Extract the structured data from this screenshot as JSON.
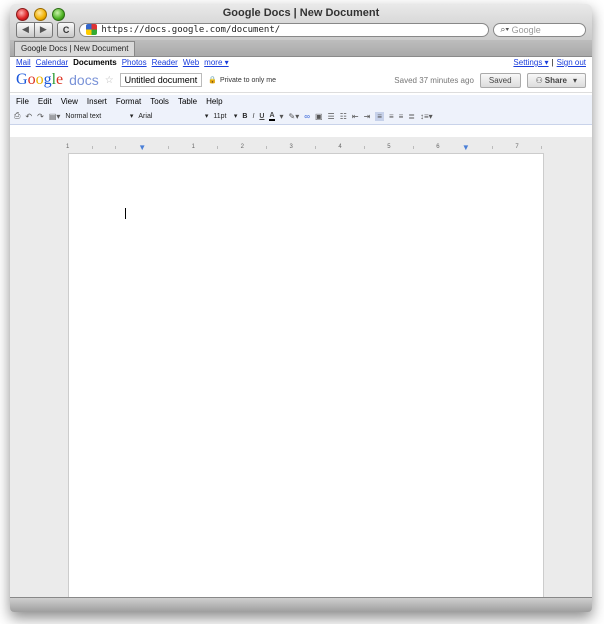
{
  "window": {
    "title": "Google Docs | New Document"
  },
  "nav": {
    "back_label": "◀",
    "forward_label": "▶",
    "reload_label": "C",
    "url": "https://docs.google.com/document/",
    "search_placeholder": "Google"
  },
  "tab": {
    "label": "Google Docs | New Document"
  },
  "gbar": {
    "links": [
      "Mail",
      "Calendar",
      "Documents",
      "Photos",
      "Reader",
      "Web",
      "more ▾"
    ],
    "active_index": 2,
    "settings": "Settings ▾",
    "divider": "|",
    "signout": "Sign out"
  },
  "docheader": {
    "logo_g": "G",
    "logo_o1": "o",
    "logo_o2": "o",
    "logo_g2": "g",
    "logo_l": "l",
    "logo_e": "e",
    "docs_word": "docs",
    "star": "☆",
    "doc_name": "Untitled document",
    "private_label": "Private to only me",
    "saved_text": "Saved 37 minutes ago",
    "saved_button": "Saved",
    "share_button": "Share",
    "share_arrow": "▾"
  },
  "menu": [
    "File",
    "Edit",
    "View",
    "Insert",
    "Format",
    "Tools",
    "Table",
    "Help"
  ],
  "toolbar": {
    "style": "Normal text",
    "font": "Arial",
    "size": "11pt",
    "bold": "B",
    "italic": "I",
    "underline": "U",
    "textcolor": "A"
  },
  "ruler": {
    "numbers": [
      "1",
      "1",
      "2",
      "3",
      "4",
      "5",
      "6",
      "7"
    ]
  },
  "colors": {
    "accent": "#1a57db",
    "toolbar_bg": "#eef2fb"
  }
}
